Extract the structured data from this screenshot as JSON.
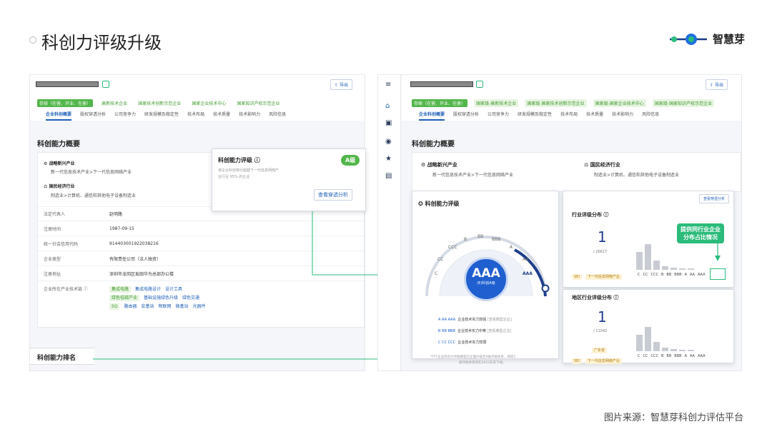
{
  "page": {
    "title": "科创力评级升级",
    "brand": "智慧芽",
    "footer": "图片来源：智慧芽科创力评估平台"
  },
  "colors": {
    "accent": "#1f5fb8",
    "green": "#52b64a",
    "callout": "#2bbb7a"
  },
  "company": {
    "export": "导出",
    "status": "存续（在营、开业、在册）",
    "tags_left": [
      "高新技术企业",
      "国家技术创新示范企业",
      "国家企业技术中心",
      "国家知识产权示范企业"
    ],
    "tags_right": [
      "国家级-高新技术企业",
      "国家级-国家技术创新示范企业",
      "国家级-国家企业技术中心",
      "国家级-国家知识产权示范企业"
    ]
  },
  "tabs": [
    "企业科创概要",
    "股权穿透分析",
    "公司竞争力",
    "研发规模及稳定性",
    "技术布局",
    "技术质量",
    "技术影响力",
    "风险信息"
  ],
  "overview": {
    "heading": "科创能力概要",
    "ind1_title": "战略新兴产业",
    "ind1_value": "新一代信息技术产业>下一代信息网络产业",
    "ind2_title": "国民经济行业",
    "ind2_value": "制造业>计算机、通信和其他电子设备制造业"
  },
  "rating_popup": {
    "title": "科创能力评级",
    "grade": "A级",
    "desc1": "该企业科创得分超越下一代信息网络产",
    "desc2": "业行业 95% 的企业",
    "button": "查看穿透分析"
  },
  "info": [
    {
      "k": "法定代表人",
      "v": "赵明路"
    },
    {
      "k": "注册时间",
      "v": "1987-09-15"
    },
    {
      "k": "统一社会信用代码",
      "v": "914403001922038216"
    },
    {
      "k": "企业类型",
      "v": "有限责任公司（法人独资）"
    },
    {
      "k": "注册地址",
      "v": "深圳市龙岗区坂田华为总部办公楼"
    }
  ],
  "chain": {
    "label": "企业所在产业技术链",
    "line1": [
      "集成电路",
      "集成电路设计",
      "设计工具"
    ],
    "line2": [
      "绿色低碳产业",
      "基础设施绿色升级",
      "绿色交通"
    ],
    "line3": [
      "5G",
      "路由器",
      "宏基站",
      "物联网",
      "微基站",
      "光器件"
    ]
  },
  "ranking_label": "科创能力排名",
  "rating": {
    "title": "科创能力评级",
    "grade": "AAA",
    "sub": "(E)科创A级",
    "gauge_labels": [
      "C",
      "CC",
      "CCC",
      "B",
      "BB",
      "BBB",
      "A",
      "AA",
      "AAA"
    ],
    "legend": [
      {
        "codes": "A AA AAA",
        "text": "企业技术实力较强",
        "link": "[查看典型企业]"
      },
      {
        "codes": "B BB BBB",
        "text": "企业技术实力中等",
        "link": "[查看典型企业]"
      },
      {
        "codes": "C CC CCC",
        "text": "企业技术实力较弱",
        "link": ""
      }
    ],
    "note1": "*TFF企业科创力评级模型已全面升级至9级评级体系，目前1",
    "note2": "级评级体系将在2022年末下线。"
  },
  "industry_dist": {
    "title": "行业评级分布",
    "rank": "1",
    "total": "/ 26617",
    "sei": "SEI",
    "sei_tag": "下一代信息网络产业",
    "button": "查看穿透分析",
    "callout1": "提供同行业企业",
    "callout2": "分布占比情况",
    "bars": [
      0.0,
      0.0,
      0.0,
      0.6,
      0.85,
      0.3,
      0.12,
      0.08,
      0.05,
      0.04
    ]
  },
  "region_dist": {
    "title": "地区行业评级分布",
    "rank": "1",
    "total": "/ 11042",
    "region": "广东省",
    "sei": "SEI",
    "sei_tag": "下一代信息网络产业",
    "bars": [
      0.0,
      0.0,
      0.0,
      0.55,
      0.8,
      0.3,
      0.12,
      0.08,
      0.05,
      0.04
    ]
  },
  "xlabels": [
    "C",
    "CC",
    "CCC",
    "B",
    "BB",
    "BBB",
    "A",
    "AA",
    "AAA"
  ]
}
